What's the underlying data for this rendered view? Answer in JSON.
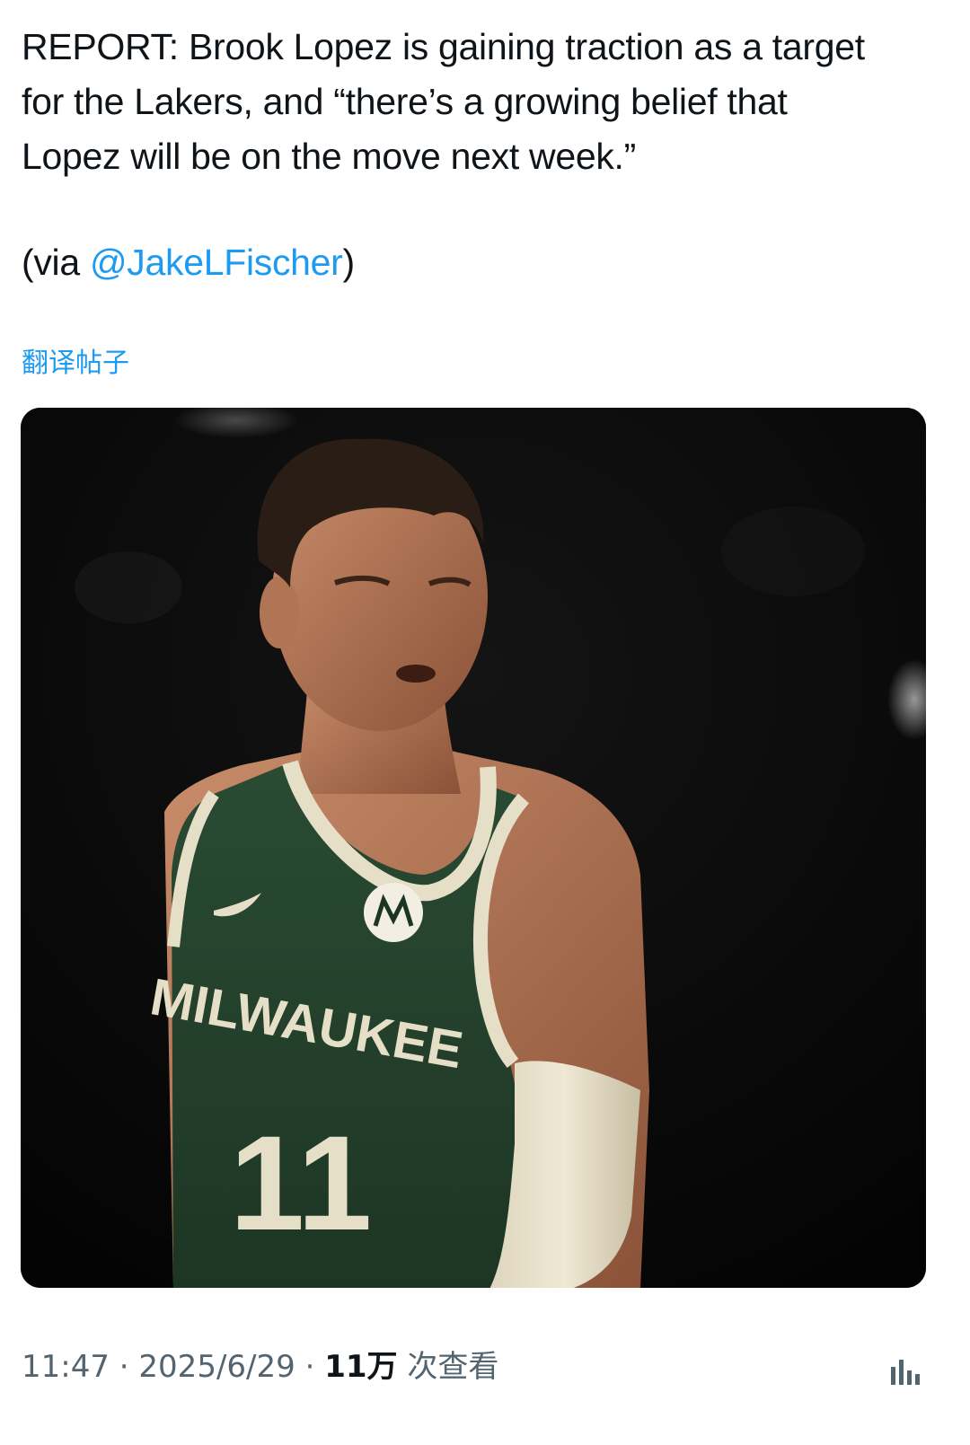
{
  "tweet": {
    "line1": "REPORT: Brook Lopez is gaining traction as a target",
    "line2": "for the Lakers, and “there’s a growing belief that",
    "line3": "Lopez will be on the move next week.”",
    "via_prefix": "(via ",
    "mention": "@JakeLFischer",
    "via_suffix": ")"
  },
  "translate_label": "翻译帖子",
  "photo": {
    "jersey_text": "MILWAUKEE",
    "jersey_number": "11",
    "colors": {
      "jersey_green": "#23422c",
      "trim_cream": "#e6dfc7",
      "background": "#060606"
    }
  },
  "meta": {
    "time": "11:47",
    "separator": " · ",
    "date": "2025/6/29",
    "views_count": "11万",
    "views_label": " 次查看"
  },
  "icons": {
    "stats": "bar-chart-icon"
  }
}
